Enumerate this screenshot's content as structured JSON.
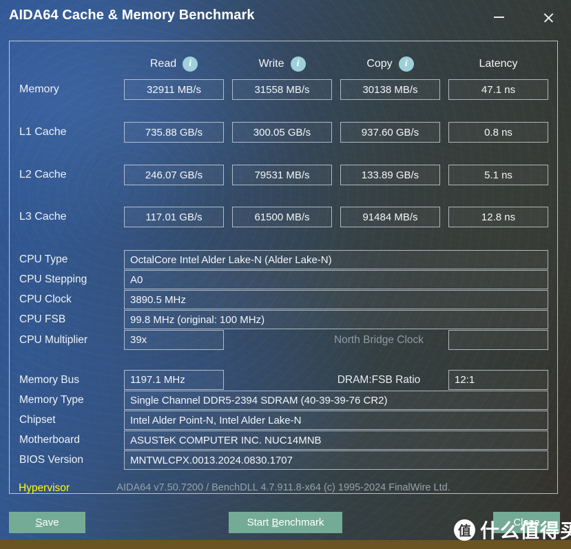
{
  "window": {
    "title": "AIDA64 Cache & Memory Benchmark",
    "minimize_label": "minimize",
    "close_label": "close"
  },
  "benchmark": {
    "columns": [
      {
        "label": "Read",
        "has_info": true
      },
      {
        "label": "Write",
        "has_info": true
      },
      {
        "label": "Copy",
        "has_info": true
      },
      {
        "label": "Latency",
        "has_info": false
      }
    ],
    "info_glyph": "i",
    "rows": [
      {
        "label": "Memory",
        "read": "32911 MB/s",
        "write": "31558 MB/s",
        "copy": "30138 MB/s",
        "latency": "47.1 ns"
      },
      {
        "label": "L1 Cache",
        "read": "735.88 GB/s",
        "write": "300.05 GB/s",
        "copy": "937.60 GB/s",
        "latency": "0.8 ns"
      },
      {
        "label": "L2 Cache",
        "read": "246.07 GB/s",
        "write": "79531 MB/s",
        "copy": "133.89 GB/s",
        "latency": "5.1 ns"
      },
      {
        "label": "L3 Cache",
        "read": "117.01 GB/s",
        "write": "61500 MB/s",
        "copy": "91484 MB/s",
        "latency": "12.8 ns"
      }
    ]
  },
  "cpu_info": {
    "type_label": "CPU Type",
    "type_value": "OctalCore Intel Alder Lake-N  (Alder Lake-N)",
    "stepping_label": "CPU Stepping",
    "stepping_value": "A0",
    "clock_label": "CPU Clock",
    "clock_value": "3890.5 MHz",
    "fsb_label": "CPU FSB",
    "fsb_value": "99.8 MHz  (original: 100 MHz)",
    "multiplier_label": "CPU Multiplier",
    "multiplier_value": "39x",
    "north_bridge_label": "North Bridge Clock",
    "north_bridge_value": ""
  },
  "system_info": {
    "memory_bus_label": "Memory Bus",
    "memory_bus_value": "1197.1 MHz",
    "dram_ratio_label": "DRAM:FSB Ratio",
    "dram_ratio_value": "12:1",
    "memory_type_label": "Memory Type",
    "memory_type_value": "Single Channel DDR5-2394 SDRAM  (40-39-39-76 CR2)",
    "chipset_label": "Chipset",
    "chipset_value": "Intel Alder Point-N, Intel Alder Lake-N",
    "motherboard_label": "Motherboard",
    "motherboard_value": "ASUSTeK COMPUTER INC. NUC14MNB",
    "bios_label": "BIOS Version",
    "bios_value": "MNTWLCPX.0013.2024.0830.1707"
  },
  "footer": {
    "hypervisor_label": "Hypervisor",
    "version_text": "AIDA64 v7.50.7200 / BenchDLL 4.7.911.8-x64  (c) 1995-2024 FinalWire Ltd."
  },
  "buttons": {
    "save_pre": "",
    "save_accel": "S",
    "save_post": "ave",
    "start_pre": "Start ",
    "start_accel": "B",
    "start_post": "enchmark",
    "close": "Close"
  },
  "watermark": {
    "logo_char": "值",
    "text": "什么值得买"
  },
  "colors": {
    "accent_button": "#74ab96",
    "info_icon": "#9fd0da",
    "hypervisor": "#ffff00",
    "bottom_strip": "#6b5422"
  }
}
